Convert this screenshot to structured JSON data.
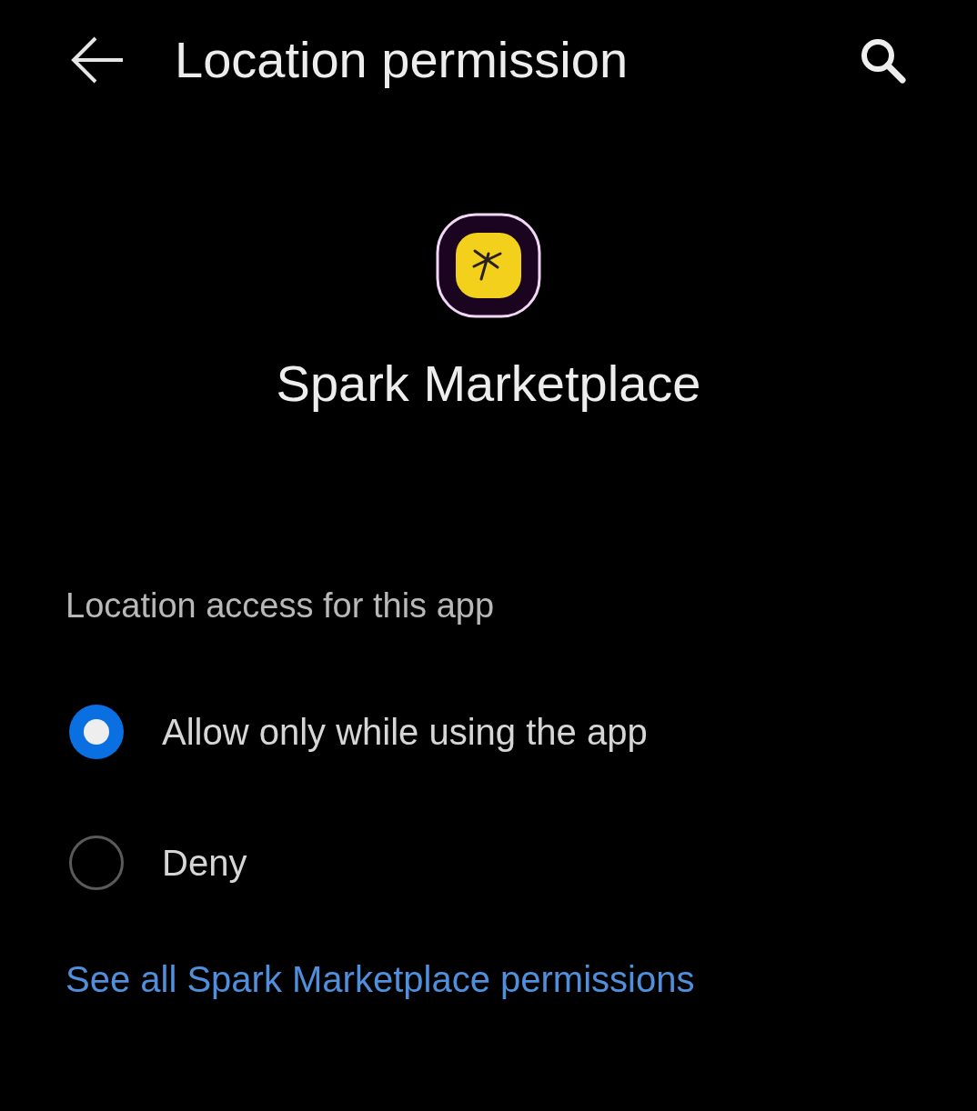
{
  "header": {
    "title": "Location permission"
  },
  "app": {
    "name": "Spark Marketplace"
  },
  "section": {
    "title": "Location access for this app"
  },
  "options": [
    {
      "label": "Allow only while using the app",
      "selected": true
    },
    {
      "label": "Deny",
      "selected": false
    }
  ],
  "link": "See all Spark Marketplace permissions"
}
